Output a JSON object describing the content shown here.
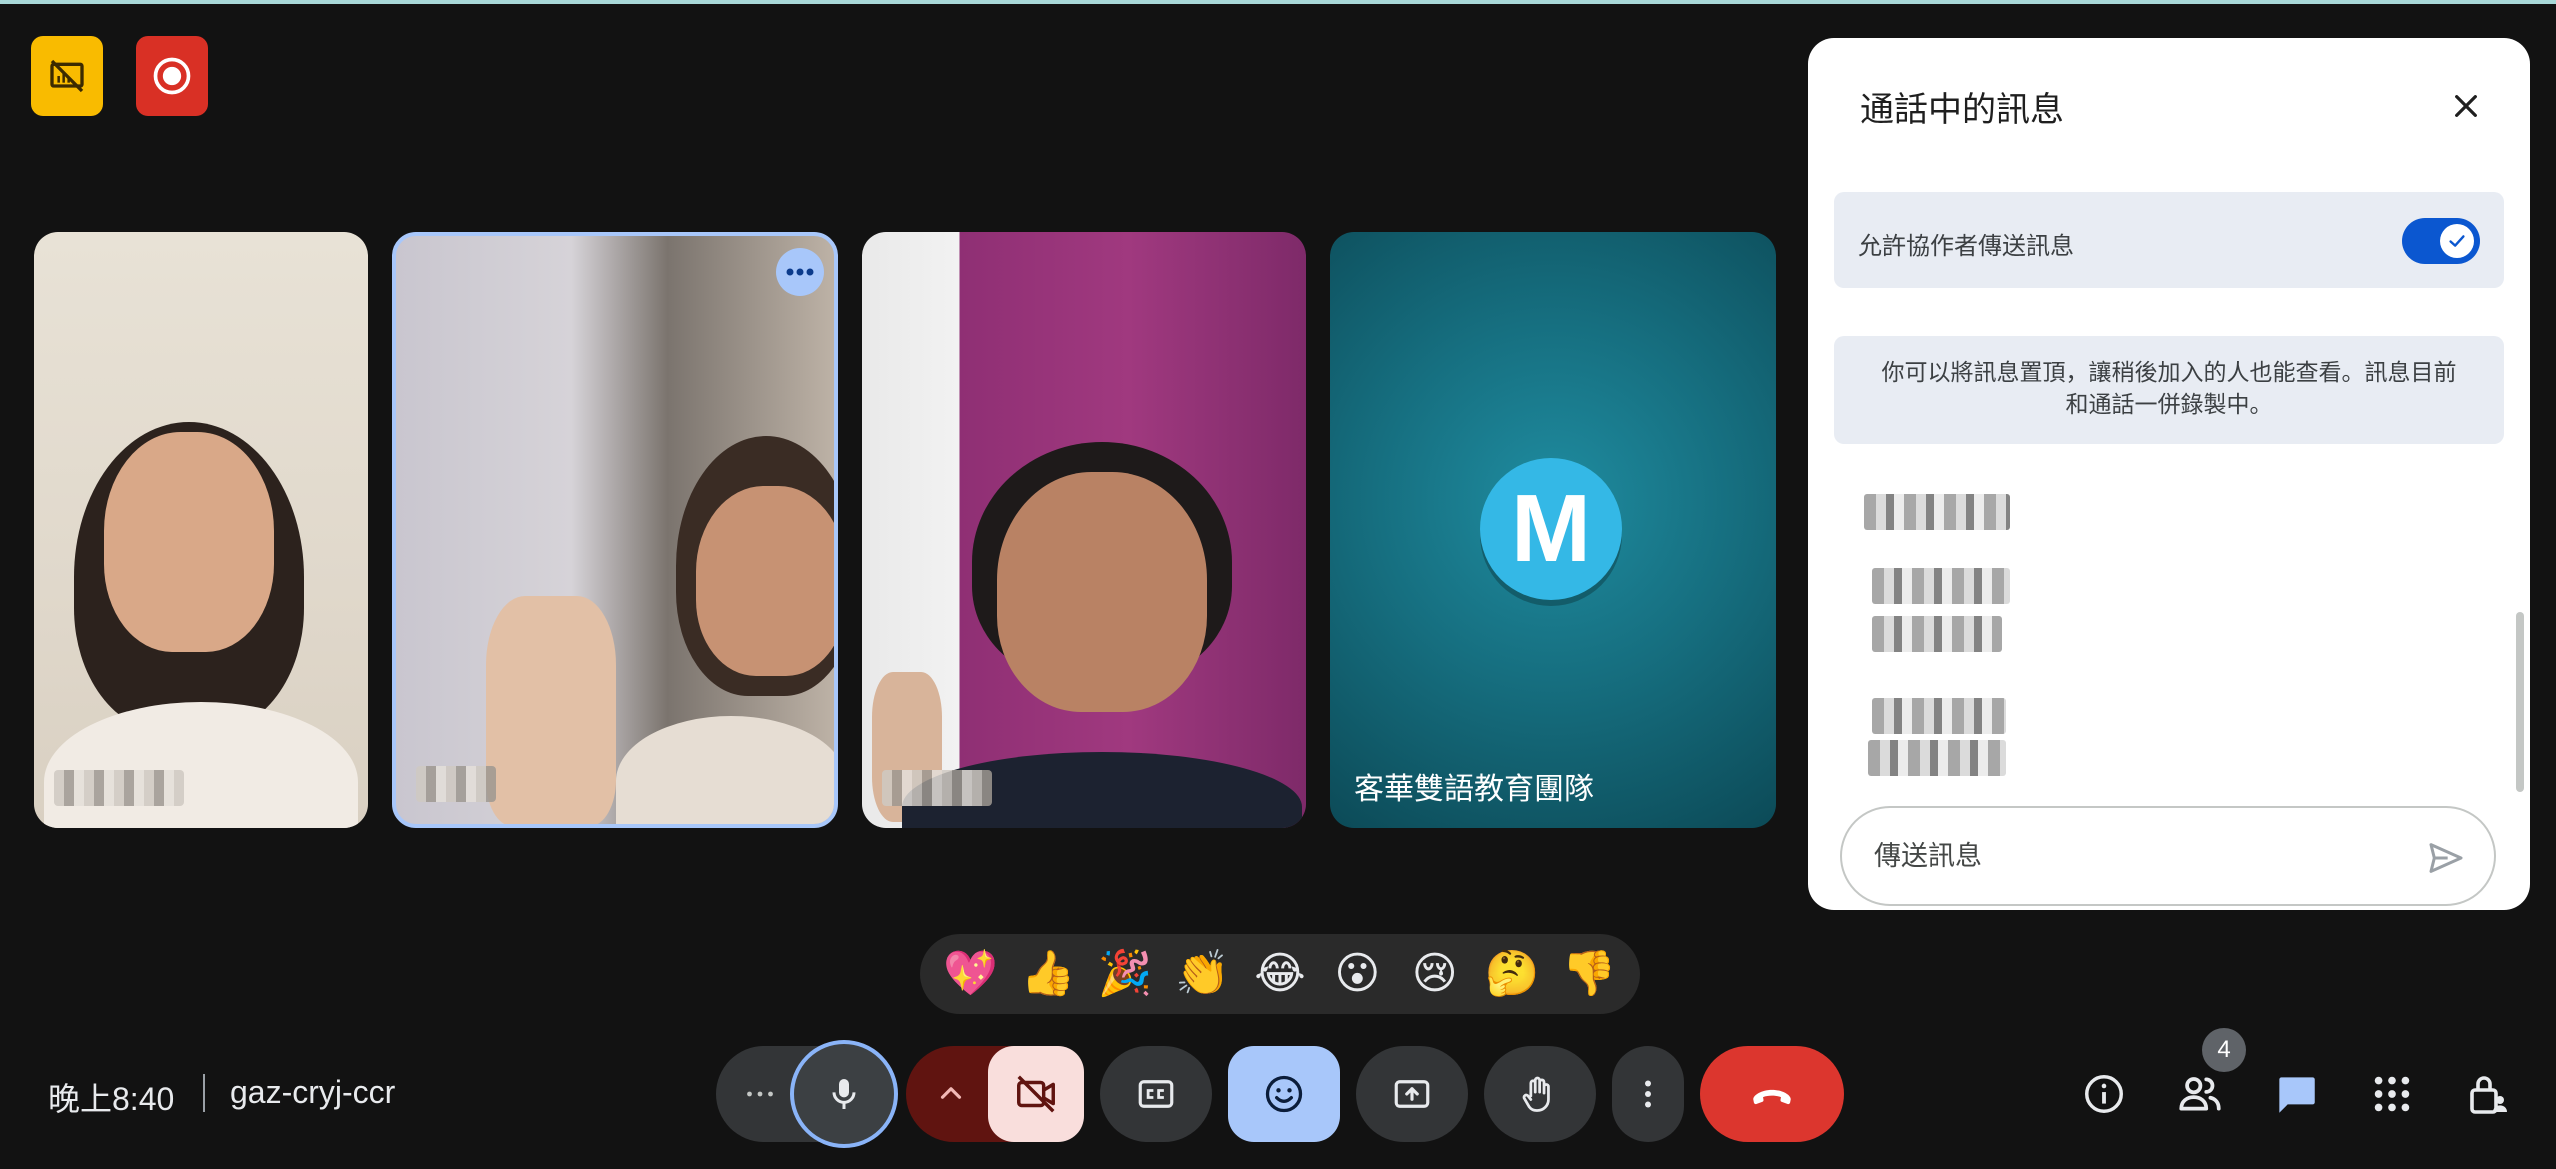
{
  "top_badges": [
    {
      "name": "no-screen-share-icon",
      "color": "#f9bb00"
    },
    {
      "name": "recording-icon",
      "color": "#d93025"
    }
  ],
  "tiles": [
    {
      "name": "participant-1",
      "pinned_more": false
    },
    {
      "name": "participant-2",
      "pinned_more": true
    },
    {
      "name": "participant-3",
      "pinned_more": false
    },
    {
      "name": "participant-4",
      "avatar_letter": "M",
      "display_name": "客華雙語教育團隊"
    }
  ],
  "chat_panel": {
    "title": "通話中的訊息",
    "allow_label": "允許協作者傳送訊息",
    "allow_enabled": true,
    "info_line1": "你可以將訊息置頂，讓稍後加入的人也能查看。訊息目前",
    "info_line2": "和通話一併錄製中。",
    "input_placeholder": "傳送訊息"
  },
  "reactions": [
    "💖",
    "👍",
    "🎉",
    "👏",
    "😂",
    "😮",
    "😢",
    "🤔",
    "👎"
  ],
  "bottom_bar": {
    "time": "晚上8:40",
    "meeting_code": "gaz-cryj-ccr",
    "participant_count": "4"
  },
  "colors": {
    "accent_blue": "#a8c7fa",
    "end_call_red": "#dc362e",
    "toggle_blue": "#0b57d0",
    "background": "#121212"
  }
}
